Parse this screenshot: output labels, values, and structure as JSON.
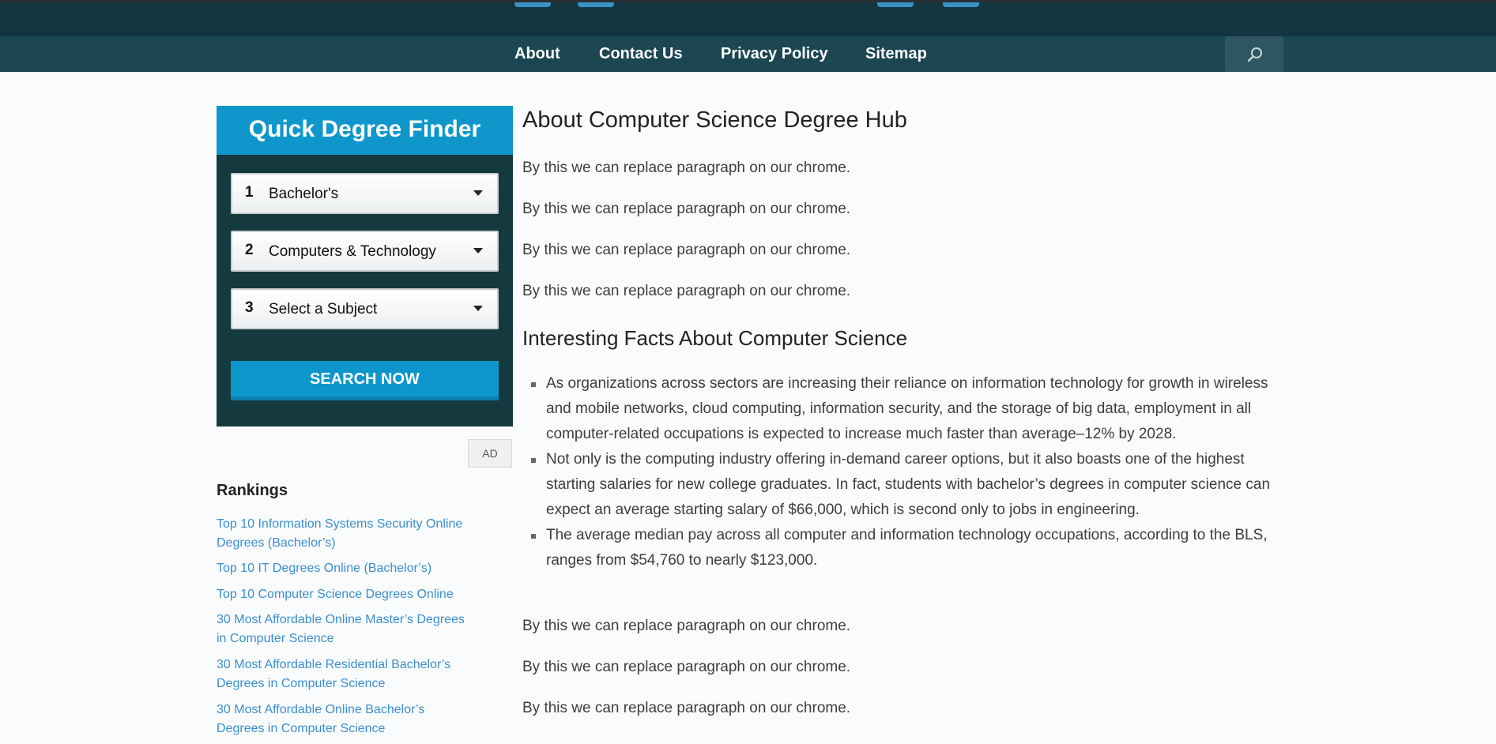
{
  "nav": {
    "links": [
      "About",
      "Contact Us",
      "Privacy Policy",
      "Sitemap"
    ]
  },
  "finder": {
    "title": "Quick Degree Finder",
    "selects": [
      {
        "num": "1",
        "value": "Bachelor's"
      },
      {
        "num": "2",
        "value": "Computers & Technology"
      },
      {
        "num": "3",
        "value": "Select a Subject"
      }
    ],
    "search_label": "SEARCH NOW",
    "ad_label": "AD"
  },
  "rankings": {
    "title": "Rankings",
    "links": [
      "Top 10 Information Systems Security Online Degrees (Bachelor’s)",
      "Top 10 IT Degrees Online (Bachelor’s)",
      "Top 10 Computer Science Degrees Online",
      "30 Most Affordable Online Master’s Degrees in Computer Science",
      "30 Most Affordable Residential Bachelor’s Degrees in Computer Science",
      "30 Most Affordable Online Bachelor’s Degrees in Computer Science"
    ]
  },
  "main": {
    "heading": "About Computer Science Degree Hub",
    "paragraphs_top": [
      "By this we can replace paragraph on our chrome.",
      "By this we can replace paragraph on our chrome.",
      "By this we can replace paragraph on our chrome.",
      "By this we can replace paragraph on our chrome."
    ],
    "subheading": "Interesting Facts About Computer Science",
    "facts": [
      "As organizations across sectors are increasing their reliance on information technology for growth in wireless and mobile networks, cloud computing, information security, and the storage of big data, employment in all computer-related occupations is expected to increase much faster than average–12% by 2028.",
      "Not only is the computing industry offering in-demand career options, but it also boasts one of the highest starting salaries for new college graduates. In fact, students with bachelor’s degrees in computer science can expect an average starting salary of $66,000, which is second only to jobs in engineering.",
      "The average median pay across all computer and information technology occupations, according to the BLS, ranges from $54,760 to nearly $123,000."
    ],
    "paragraphs_bottom": [
      "By this we can replace paragraph on our chrome.",
      "By this we can replace paragraph on our chrome.",
      "By this we can replace paragraph on our chrome."
    ]
  },
  "colors": {
    "topbar": "#12353f",
    "navbar": "#1b4652",
    "finder_header": "#0f97cb",
    "finder_body": "#14393f",
    "link": "#3a8fd1"
  },
  "icons": {
    "search": "magnifier-icon"
  }
}
